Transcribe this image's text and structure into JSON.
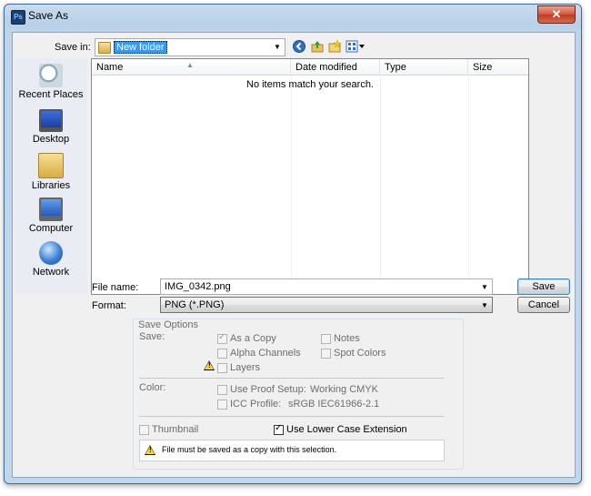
{
  "window": {
    "title": "Save As",
    "app_icon": "Ps",
    "close_glyph": "✕"
  },
  "nav": {
    "save_in_label": "Save in:",
    "current_folder": "New folder",
    "toolbar_icons": [
      "back-icon",
      "up-folder-icon",
      "new-folder-icon",
      "view-menu-icon"
    ]
  },
  "places": [
    {
      "label": "Recent Places",
      "icon": "recent-places-icon"
    },
    {
      "label": "Desktop",
      "icon": "desktop-icon"
    },
    {
      "label": "Libraries",
      "icon": "libraries-icon"
    },
    {
      "label": "Computer",
      "icon": "computer-icon"
    },
    {
      "label": "Network",
      "icon": "network-icon"
    }
  ],
  "filelist": {
    "columns": [
      "Name",
      "Date modified",
      "Type",
      "Size"
    ],
    "empty_message": "No items match your search."
  },
  "form": {
    "file_name_label": "File name:",
    "file_name_value": "IMG_0342.png",
    "format_label": "Format:",
    "format_value": "PNG (*.PNG)",
    "save_button": "Save",
    "cancel_button": "Cancel"
  },
  "options": {
    "title": "Save Options",
    "save_label": "Save:",
    "as_a_copy": "As a Copy",
    "notes": "Notes",
    "alpha_channels": "Alpha Channels",
    "spot_colors": "Spot Colors",
    "layers": "Layers",
    "color_label": "Color:",
    "use_proof_setup": "Use Proof Setup:",
    "proof_value": "Working CMYK",
    "icc_profile": "ICC Profile:",
    "icc_value": "sRGB IEC61966-2.1",
    "thumbnail": "Thumbnail",
    "lower_case_ext": "Use Lower Case Extension",
    "warning": "File must be saved as a copy with this selection."
  }
}
